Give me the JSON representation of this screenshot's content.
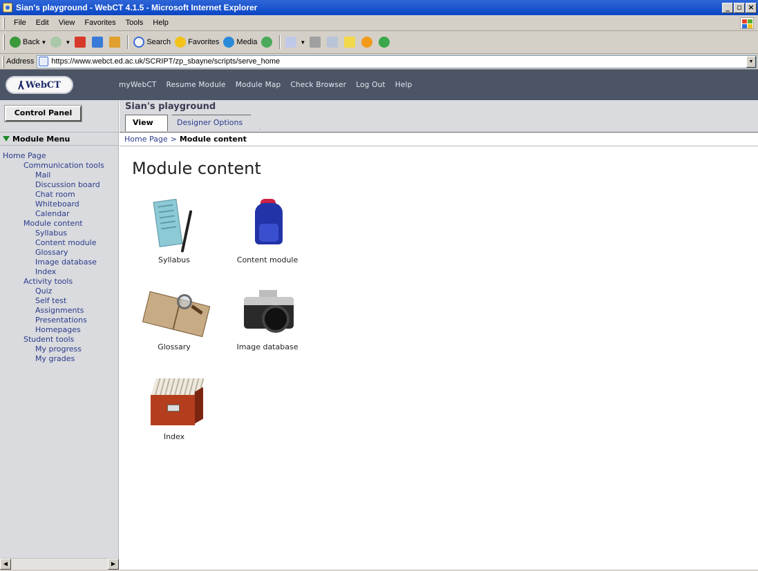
{
  "window": {
    "title": "Sian's playground - WebCT 4.1.5 - Microsoft Internet Explorer",
    "controls": [
      "_",
      "▫",
      "×"
    ]
  },
  "menubar": {
    "items": [
      "File",
      "Edit",
      "View",
      "Favorites",
      "Tools",
      "Help"
    ]
  },
  "toolbar": {
    "back_label": "Back",
    "search_label": "Search",
    "favorites_label": "Favorites",
    "media_label": "Media"
  },
  "addressbar": {
    "label": "Address",
    "url": "https://www.webct.ed.ac.uk/SCRIPT/zp_sbayne/scripts/serve_home"
  },
  "webct": {
    "logo_text": "WebCT",
    "nav": [
      "myWebCT",
      "Resume Module",
      "Module Map",
      "Check Browser",
      "Log Out",
      "Help"
    ]
  },
  "left": {
    "control_panel_label": "Control Panel",
    "module_menu_label": "Module Menu",
    "items": [
      {
        "label": "Home Page",
        "level": 0
      },
      {
        "label": "Communication tools",
        "level": 1
      },
      {
        "label": "Mail",
        "level": 2
      },
      {
        "label": "Discussion board",
        "level": 2
      },
      {
        "label": "Chat room",
        "level": 2
      },
      {
        "label": "Whiteboard",
        "level": 2
      },
      {
        "label": "Calendar",
        "level": 2
      },
      {
        "label": "Module content",
        "level": 1
      },
      {
        "label": "Syllabus",
        "level": 2
      },
      {
        "label": "Content module",
        "level": 2
      },
      {
        "label": "Glossary",
        "level": 2
      },
      {
        "label": "Image database",
        "level": 2
      },
      {
        "label": "Index",
        "level": 2
      },
      {
        "label": "Activity tools",
        "level": 1
      },
      {
        "label": "Quiz",
        "level": 2
      },
      {
        "label": "Self test",
        "level": 2
      },
      {
        "label": "Assignments",
        "level": 2
      },
      {
        "label": "Presentations",
        "level": 2
      },
      {
        "label": "Homepages",
        "level": 2
      },
      {
        "label": "Student tools",
        "level": 1
      },
      {
        "label": "My progress",
        "level": 2
      },
      {
        "label": "My grades",
        "level": 2
      }
    ]
  },
  "course": {
    "title": "Sian's playground",
    "tabs": [
      "View",
      "Designer Options"
    ]
  },
  "breadcrumb": {
    "home": "Home Page",
    "separator": ">",
    "current": "Module content"
  },
  "main": {
    "title": "Module content",
    "tiles": [
      {
        "label": "Syllabus",
        "icon": "syllabus-icon"
      },
      {
        "label": "Content module",
        "icon": "backpack-icon"
      },
      {
        "label": "Glossary",
        "icon": "book-magnifier-icon"
      },
      {
        "label": "Image database",
        "icon": "camera-icon"
      },
      {
        "label": "Index",
        "icon": "card-index-box-icon"
      }
    ]
  },
  "colors": {
    "webct_header": "#4b5566",
    "side_panel": "#d9dbde",
    "link": "#2b3a8c",
    "module_menu_triangle": "#1e8a2a"
  }
}
